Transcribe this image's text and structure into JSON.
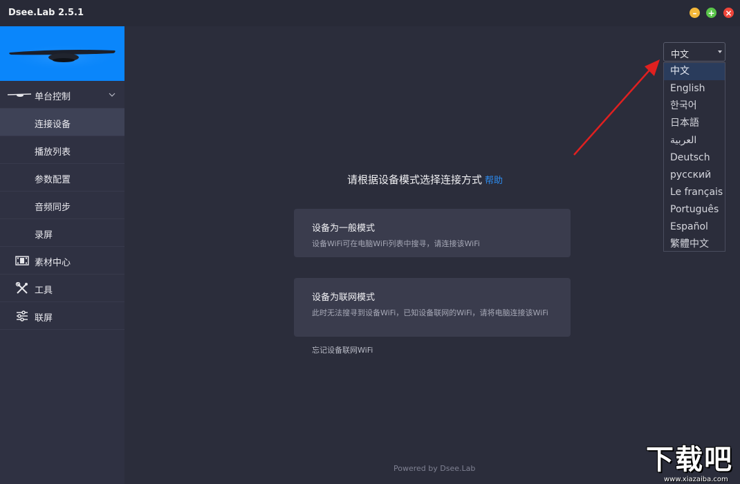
{
  "window": {
    "title": "Dsee.Lab 2.5.1",
    "minimize_glyph": "–",
    "maximize_glyph": "+",
    "close_glyph": "×"
  },
  "sidebar": {
    "sections": [
      {
        "label": "单台控制",
        "icon": "device-icon",
        "expanded": true
      },
      {
        "label": "连接设备",
        "active": true
      },
      {
        "label": "播放列表"
      },
      {
        "label": "参数配置"
      },
      {
        "label": "音频同步"
      },
      {
        "label": "录屏"
      },
      {
        "label": "素材中心",
        "icon": "film-icon"
      },
      {
        "label": "工具",
        "icon": "tools-icon"
      },
      {
        "label": "联屏",
        "icon": "sliders-icon"
      }
    ]
  },
  "main": {
    "heading": "请根据设备模式选择连接方式",
    "help_link": "帮助",
    "cards": [
      {
        "title": "设备为一般模式",
        "desc": "设备WiFi可在电脑WiFi列表中搜寻，请连接该WiFi"
      },
      {
        "title": "设备为联网模式",
        "desc": "此时无法搜寻到设备WiFi，已知设备联网的WiFi，请将电脑连接该WiFi"
      }
    ],
    "forget_link": "忘记设备联网WiFi",
    "powered_by": "Powered by Dsee.Lab"
  },
  "language": {
    "selected": "中文",
    "options": [
      "中文",
      "English",
      "한국어",
      "日本語",
      "العربية",
      "Deutsch",
      "русский",
      "Le français",
      "Português",
      "Español",
      "繁體中文"
    ]
  },
  "watermark": {
    "brand": "下载吧",
    "url": "www.xiazaiba.com"
  },
  "colors": {
    "accent": "#0a86fb",
    "link": "#2d8cf0",
    "arrow": "#e02020",
    "background": "#2b2d3b",
    "sidebar": "#2f3142"
  }
}
